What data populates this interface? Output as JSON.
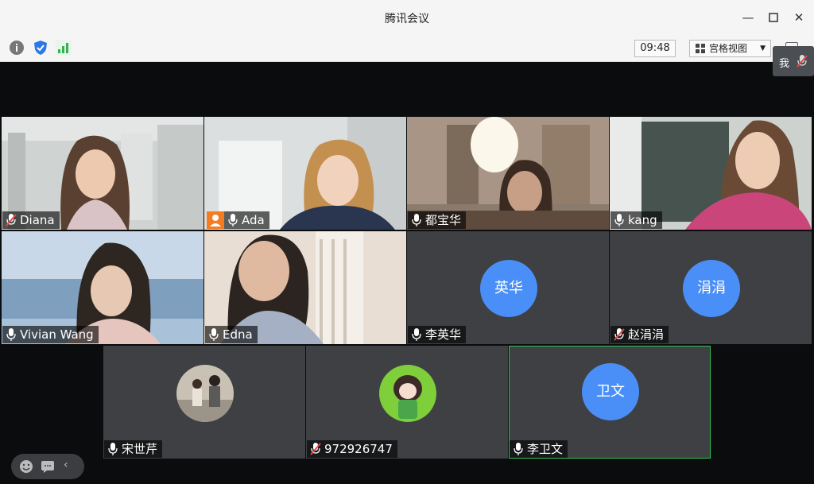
{
  "window": {
    "title": "腾讯会议"
  },
  "toolbar": {
    "time": "09:48",
    "view_label": "宫格视图"
  },
  "self_view": {
    "label": "我"
  },
  "participants": [
    {
      "name": "Diana",
      "mic": "muted"
    },
    {
      "name": "Ada",
      "mic": "on"
    },
    {
      "name": "都宝华",
      "mic": "on"
    },
    {
      "name": "kang",
      "mic": "on"
    },
    {
      "name": "Vivian Wang",
      "mic": "on"
    },
    {
      "name": "Edna",
      "mic": "on"
    },
    {
      "name": "李英华",
      "mic": "on",
      "avatar_text": "英华"
    },
    {
      "name": "赵涓涓",
      "mic": "muted",
      "avatar_text": "涓涓"
    },
    {
      "name": "宋世芹",
      "mic": "on"
    },
    {
      "name": "972926747",
      "mic": "muted"
    },
    {
      "name": "李卫文",
      "mic": "on",
      "avatar_text": "卫文",
      "active_speaker": true
    }
  ],
  "colors": {
    "avatar_blue": "#4a8ff7",
    "active_green": "#33c35a",
    "host_orange": "#f57c1f",
    "tile_gray": "#3e4043"
  },
  "icons": [
    "info-icon",
    "shield-icon",
    "signal-icon",
    "grid-view-icon",
    "fullscreen-icon",
    "mic-icon",
    "mic-muted-icon",
    "smile-icon",
    "chat-icon",
    "chevron-left-icon",
    "host-user-icon"
  ]
}
